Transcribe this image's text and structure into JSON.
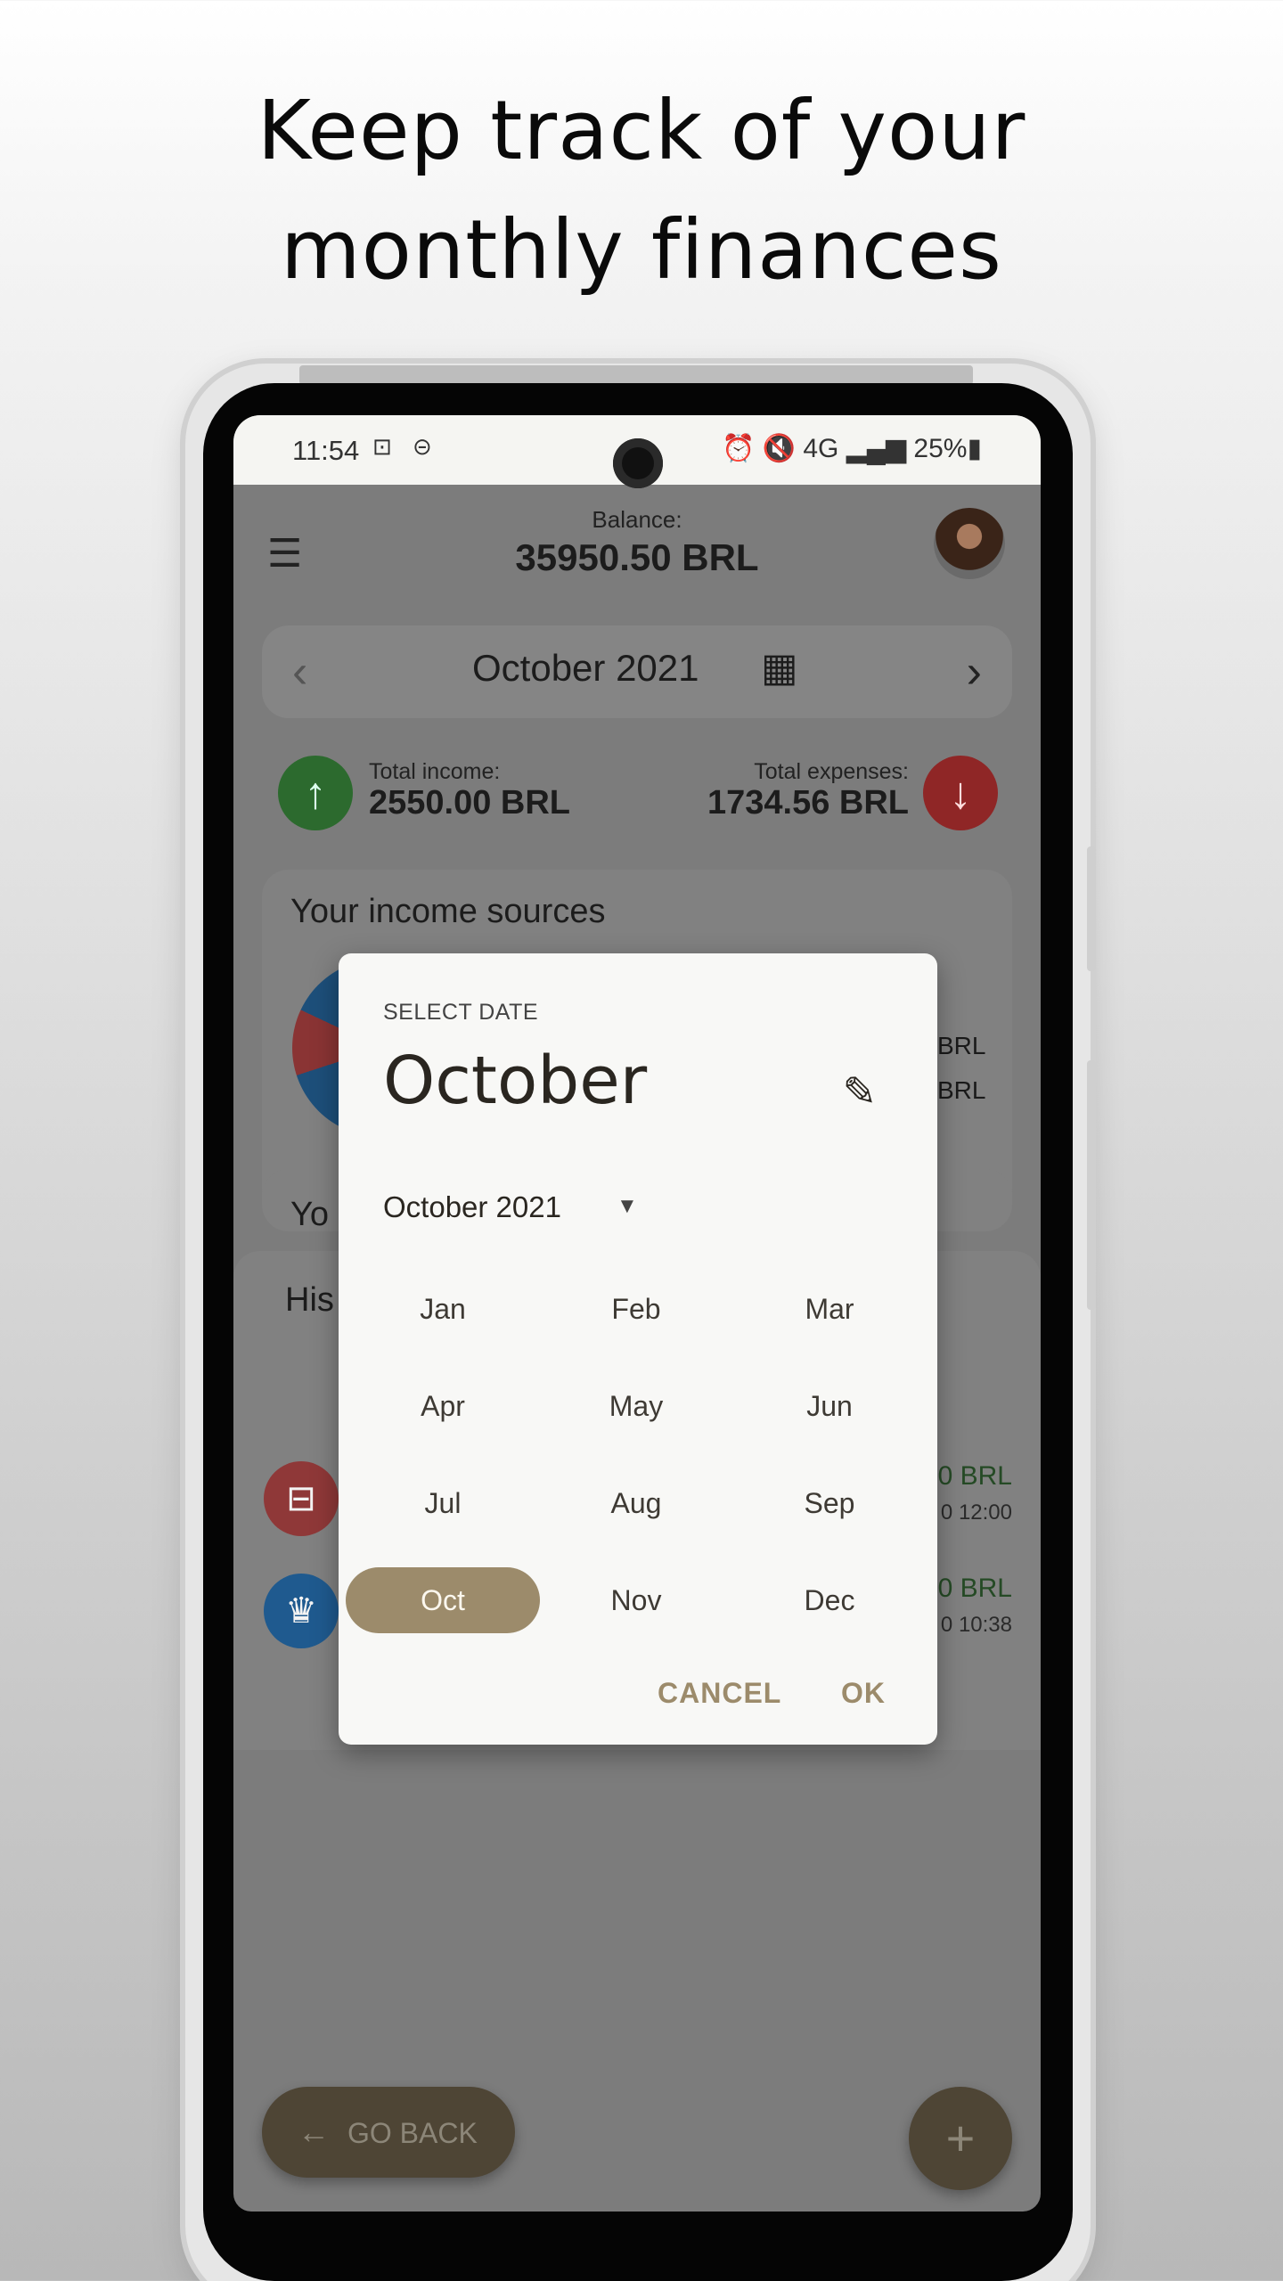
{
  "headline": {
    "line1": "Keep track of your",
    "line2": "monthly finances"
  },
  "status_bar": {
    "time": "11:54",
    "left_icons": "⊡ ⊝",
    "right_icons": "⏰ 🔇 4G ▂▄▆ 25%▮"
  },
  "header": {
    "menu_icon": "menu-icon",
    "balance_label": "Balance:",
    "balance_value": "35950.50 BRL"
  },
  "month_nav": {
    "prev": "‹",
    "label": "October 2021",
    "next": "›",
    "calendar_icon": "calendar-icon"
  },
  "totals": {
    "income_label": "Total income:",
    "income_value": "2550.00 BRL",
    "expenses_label": "Total expenses:",
    "expenses_value": "1734.56 BRL",
    "income_color": "#2e7d32",
    "expense_color": "#c62828"
  },
  "income_card": {
    "title": "Your income sources",
    "right_1": "BRL",
    "right_2": "BRL"
  },
  "section_partial": {
    "yo": "Yo",
    "his": "His"
  },
  "history": [
    {
      "icon": "gift-icon",
      "amount": "0 BRL",
      "time": "0 12:00",
      "color": "#8f3838"
    },
    {
      "icon": "trophy-icon",
      "amount": "0 BRL",
      "time": "0 10:38",
      "color": "#1f5a8f"
    }
  ],
  "bottom": {
    "go_back": "GO BACK",
    "fab": "+"
  },
  "dialog": {
    "select_label": "SELECT DATE",
    "heading": "October",
    "year_label": "October 2021",
    "months": [
      "Jan",
      "Feb",
      "Mar",
      "Apr",
      "May",
      "Jun",
      "Jul",
      "Aug",
      "Sep",
      "Oct",
      "Nov",
      "Dec"
    ],
    "selected_month": "Oct",
    "cancel": "CANCEL",
    "ok": "OK",
    "accent": "#9c8b6b"
  }
}
